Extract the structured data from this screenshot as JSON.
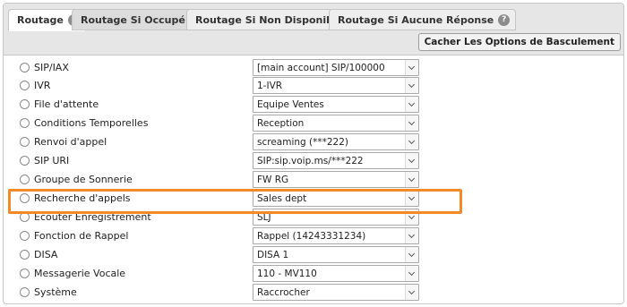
{
  "tabs": [
    {
      "label": "Routage",
      "help_icon": "help-icon"
    },
    {
      "label": "Routage Si Occupé",
      "help_icon": "help-icon"
    },
    {
      "label": "Routage Si Non Disponible",
      "help_icon": "help-icon"
    },
    {
      "label": "Routage Si Aucune Réponse",
      "help_icon": "help-icon"
    }
  ],
  "toggle_button": {
    "label": "Cacher Les Options de Basculement"
  },
  "options": [
    {
      "label": "SIP/IAX",
      "value": "[main account] SIP/100000"
    },
    {
      "label": "IVR",
      "value": "1-IVR"
    },
    {
      "label": "File d'attente",
      "value": "Equipe Ventes"
    },
    {
      "label": "Conditions Temporelles",
      "value": "Reception"
    },
    {
      "label": "Renvoi d'appel",
      "value": "screaming (***222)"
    },
    {
      "label": "SIP URI",
      "value": "SIP:sip.voip.ms/***222"
    },
    {
      "label": "Groupe de Sonnerie",
      "value": "FW RG"
    },
    {
      "label": "Recherche d'appels",
      "value": "Sales dept"
    },
    {
      "label": "Écouter Enregistrement",
      "value": "SLJ"
    },
    {
      "label": "Fonction de Rappel",
      "value": "Rappel (14243331234)"
    },
    {
      "label": "DISA",
      "value": "DISA 1"
    },
    {
      "label": "Messagerie Vocale",
      "value": "110 - MV110"
    },
    {
      "label": "Système",
      "value": "Raccrocher"
    }
  ],
  "highlight_color": "#f28a2a"
}
